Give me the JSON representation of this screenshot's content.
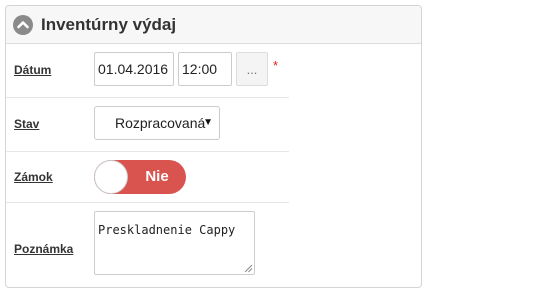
{
  "panel": {
    "title": "Inventúrny výdaj",
    "collapse_icon": "chevron-up-icon"
  },
  "form": {
    "date": {
      "label": "Dátum",
      "date_value": "01.04.2016",
      "time_value": "12:00",
      "picker_label": "...",
      "required_mark": "*"
    },
    "status": {
      "label": "Stav",
      "selected": "Rozpracovaná",
      "arrow": "▼"
    },
    "lock": {
      "label": "Zámok",
      "toggle_text": "Nie",
      "checked": false
    },
    "note": {
      "label": "Poznámka",
      "value": "Preskladnenie Cappy"
    }
  },
  "colors": {
    "toggle_off": "#d9534f",
    "required": "#e02020",
    "header_bg": "#f7f7f7"
  }
}
